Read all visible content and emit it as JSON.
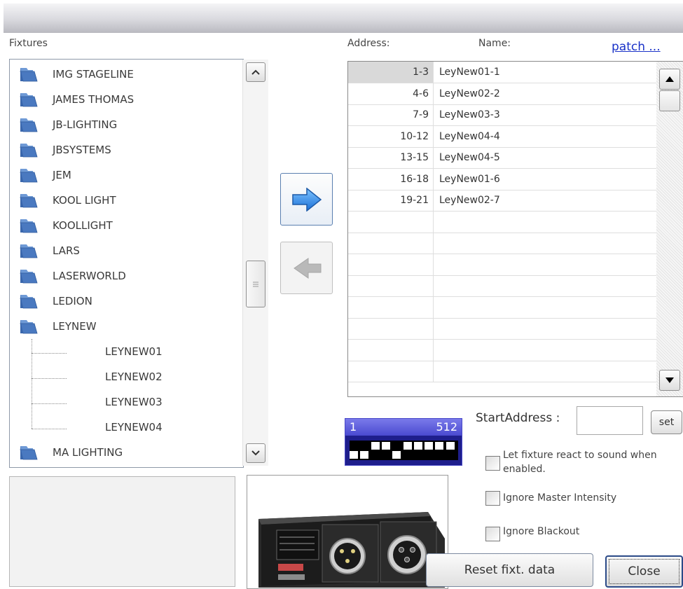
{
  "labels": {
    "fixtures": "Fixtures",
    "address": "Address:",
    "name": "Name:",
    "patch": "patch ...",
    "start_address": "StartAddress :"
  },
  "tree": {
    "items": [
      "IMG STAGELINE",
      "JAMES THOMAS",
      "JB-LIGHTING",
      "JBSYSTEMS",
      "JEM",
      "KOOL LIGHT",
      "KOOLLIGHT",
      "LARS",
      "LASERWORLD",
      "LEDION",
      "LEYNEW"
    ],
    "children": [
      "LEYNEW01",
      "LEYNEW02",
      "LEYNEW03",
      "LEYNEW04"
    ],
    "last_item": "MA LIGHTING"
  },
  "patch_table": {
    "rows": [
      {
        "address": "1-3",
        "name": "LeyNew01-1"
      },
      {
        "address": "4-6",
        "name": "LeyNew02-2"
      },
      {
        "address": "7-9",
        "name": "LeyNew03-3"
      },
      {
        "address": "10-12",
        "name": "LeyNew04-4"
      },
      {
        "address": "13-15",
        "name": "LeyNew04-5"
      },
      {
        "address": "16-18",
        "name": "LeyNew01-6"
      },
      {
        "address": "19-21",
        "name": "LeyNew02-7"
      }
    ],
    "empty_rows": 8
  },
  "dmx": {
    "start": "1",
    "end": "512",
    "occupied_cells_top": [
      2,
      3,
      5,
      6,
      7,
      8,
      9
    ],
    "occupied_cells_bottom": [
      0,
      1,
      4
    ]
  },
  "start_address_value": "",
  "buttons": {
    "set": "set",
    "reset": "Reset fixt. data",
    "close": "Close"
  },
  "options": {
    "sound_line1": "Let fixture react to sound when",
    "sound_line2": "enabled.",
    "ignore_master": "Ignore Master Intensity",
    "ignore_blackout": "Ignore Blackout"
  },
  "colors": {
    "folder": "#4a79c0",
    "arrow": "#2f8ce8",
    "dmx_bg": "#1e1e8c",
    "link": "#1a32c8"
  }
}
